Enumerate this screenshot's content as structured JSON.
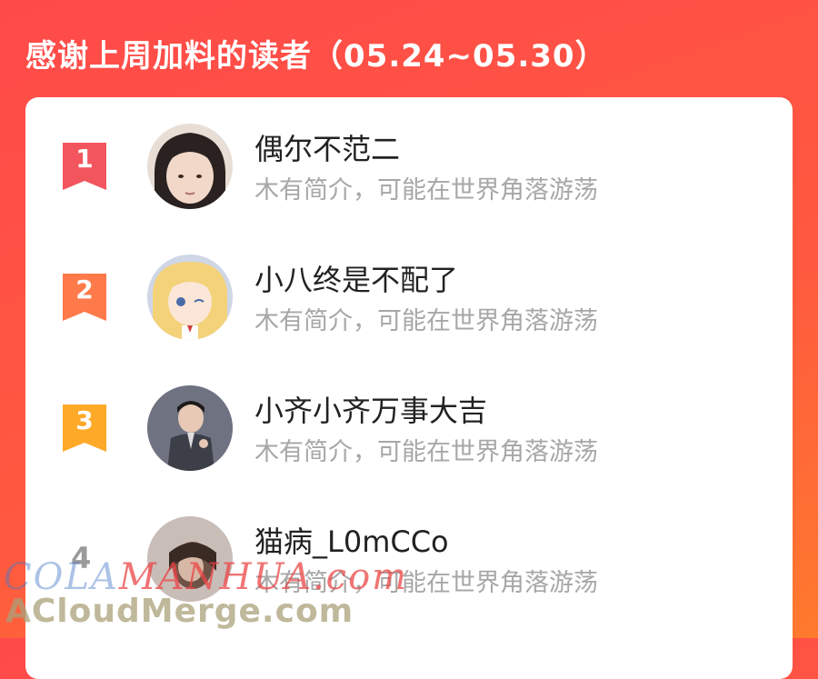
{
  "header": {
    "title": "感谢上周加料的读者（05.24~05.30）"
  },
  "colors": {
    "background_gradient": [
      "#ff4a4a",
      "#ff7a2d"
    ],
    "rank1": "#f2555e",
    "rank2": "#ff7a4a",
    "rank3": "#ffa928",
    "card": "#ffffff"
  },
  "readers": [
    {
      "rank": "1",
      "name": "偶尔不范二",
      "bio": "木有简介，可能在世界角落游荡"
    },
    {
      "rank": "2",
      "name": "小八终是不配了",
      "bio": "木有简介，可能在世界角落游荡"
    },
    {
      "rank": "3",
      "name": "小齐小齐万事大吉",
      "bio": "木有简介，可能在世界角落游荡"
    },
    {
      "rank": "4",
      "name": "猫病_L0mCCo",
      "bio": "木有简介，可能在世界角落游荡"
    }
  ],
  "watermark": {
    "line1_a": "COLA",
    "line1_b": "MANHUA.com",
    "line2": "ACloudMerge.com"
  }
}
